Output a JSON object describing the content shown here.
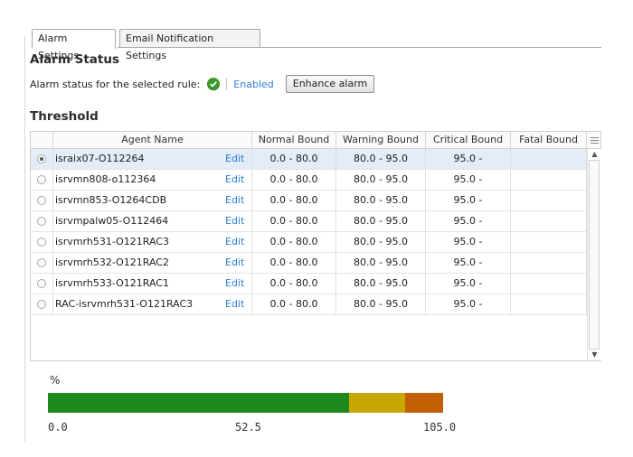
{
  "tabs": [
    {
      "label": "Alarm Settings",
      "active": true
    },
    {
      "label": "Email Notification Settings",
      "active": false
    }
  ],
  "alarm_status": {
    "heading": "Alarm Status",
    "label": "Alarm status for the selected rule:",
    "status_text": "Enabled",
    "enhance_button": "Enhance alarm"
  },
  "threshold": {
    "heading": "Threshold",
    "columns": [
      "Agent Name",
      "Normal Bound",
      "Warning Bound",
      "Critical Bound",
      "Fatal Bound"
    ],
    "rows": [
      {
        "agent": "israix07-O112264",
        "edit": "Edit",
        "normal": "0.0 - 80.0",
        "warning": "80.0 - 95.0",
        "critical": "95.0 -",
        "fatal": "",
        "selected": true
      },
      {
        "agent": "isrvmn808-o112364",
        "edit": "Edit",
        "normal": "0.0 - 80.0",
        "warning": "80.0 - 95.0",
        "critical": "95.0 -",
        "fatal": "",
        "selected": false
      },
      {
        "agent": "isrvmn853-O1264CDB",
        "edit": "Edit",
        "normal": "0.0 - 80.0",
        "warning": "80.0 - 95.0",
        "critical": "95.0 -",
        "fatal": "",
        "selected": false
      },
      {
        "agent": "isrvmpalw05-O112464",
        "edit": "Edit",
        "normal": "0.0 - 80.0",
        "warning": "80.0 - 95.0",
        "critical": "95.0 -",
        "fatal": "",
        "selected": false
      },
      {
        "agent": "isrvmrh531-O121RAC3",
        "edit": "Edit",
        "normal": "0.0 - 80.0",
        "warning": "80.0 - 95.0",
        "critical": "95.0 -",
        "fatal": "",
        "selected": false
      },
      {
        "agent": "isrvmrh532-O121RAC2",
        "edit": "Edit",
        "normal": "0.0 - 80.0",
        "warning": "80.0 - 95.0",
        "critical": "95.0 -",
        "fatal": "",
        "selected": false
      },
      {
        "agent": "isrvmrh533-O121RAC1",
        "edit": "Edit",
        "normal": "0.0 - 80.0",
        "warning": "80.0 - 95.0",
        "critical": "95.0 -",
        "fatal": "",
        "selected": false
      },
      {
        "agent": "RAC-isrvmrh531-O121RAC3",
        "edit": "Edit",
        "normal": "0.0 - 80.0",
        "warning": "80.0 - 95.0",
        "critical": "95.0 -",
        "fatal": "",
        "selected": false
      }
    ]
  },
  "gauge": {
    "unit": "%",
    "min": 0.0,
    "max": 105.0,
    "tick_labels": [
      "0.0",
      "52.5",
      "105.0"
    ],
    "segments": [
      {
        "name": "normal",
        "from": 0.0,
        "to": 80.0,
        "color": "#1e8a1e"
      },
      {
        "name": "warning",
        "from": 80.0,
        "to": 95.0,
        "color": "#c8a800"
      },
      {
        "name": "critical",
        "from": 95.0,
        "to": 105.0,
        "color": "#c06000"
      }
    ]
  },
  "colors": {
    "link": "#2d7fd1",
    "selected_row": "#e3ecf7",
    "status_ok": "#3a9a2a"
  }
}
